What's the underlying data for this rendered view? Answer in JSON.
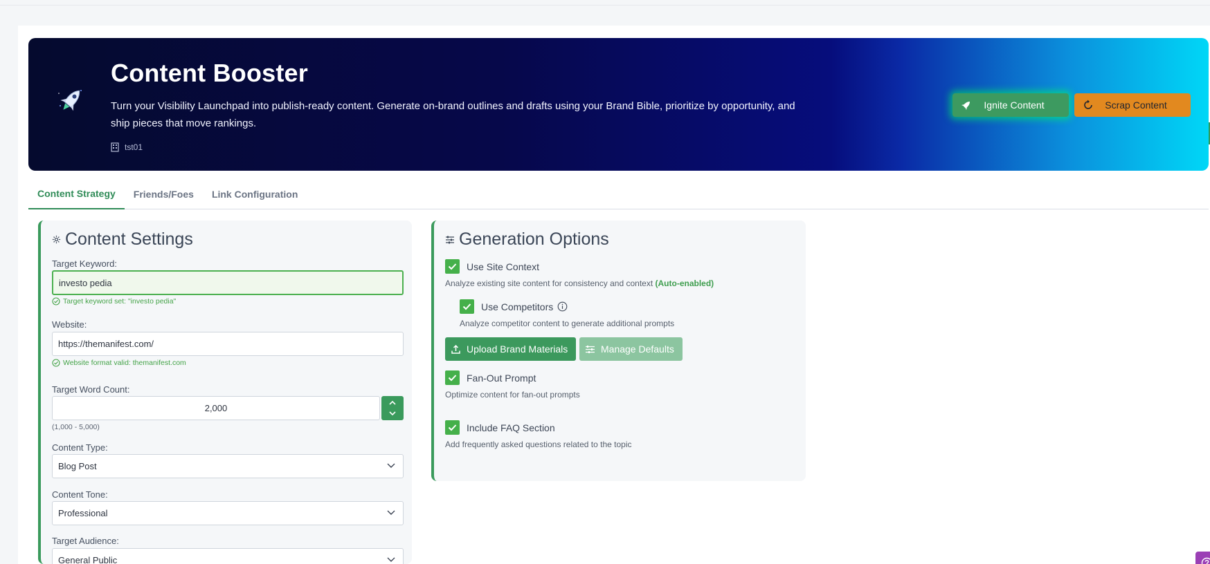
{
  "hero": {
    "title": "Content Booster",
    "description": "Turn your Visibility Launchpad into publish-ready content. Generate on-brand outlines and drafts using your Brand Bible, prioritize by opportunity, and ship pieces that move rankings.",
    "org": "tst01",
    "ignite_label": "Ignite Content",
    "scrap_label": "Scrap Content"
  },
  "tabs": [
    {
      "label": "Content Strategy",
      "active": true
    },
    {
      "label": "Friends/Foes",
      "active": false
    },
    {
      "label": "Link Configuration",
      "active": false
    }
  ],
  "content_settings": {
    "title": "Content Settings",
    "keyword_label": "Target Keyword:",
    "keyword_value": "investo pedia",
    "keyword_hint": "Target keyword set: \"investo pedia\"",
    "website_label": "Website:",
    "website_value": "https://themanifest.com/",
    "website_hint": "Website format valid: themanifest.com",
    "word_count_label": "Target Word Count:",
    "word_count_value": "2,000",
    "word_count_range": "(1,000 - 5,000)",
    "content_type_label": "Content Type:",
    "content_type_value": "Blog Post",
    "tone_label": "Content Tone:",
    "tone_value": "Professional",
    "audience_label": "Target Audience:",
    "audience_value": "General Public"
  },
  "generation_options": {
    "title": "Generation Options",
    "site_context_label": "Use Site Context",
    "site_context_desc": "Analyze existing site content for consistency and context",
    "site_context_auto": "(Auto-enabled)",
    "competitors_label": "Use Competitors",
    "competitors_desc": "Analyze competitor content to generate additional prompts",
    "upload_label": "Upload Brand Materials",
    "manage_label": "Manage Defaults",
    "fanout_label": "Fan-Out Prompt",
    "fanout_desc": "Optimize content for fan-out prompts",
    "faq_label": "Include FAQ Section",
    "faq_desc": "Add frequently asked questions related to the topic"
  },
  "colors": {
    "accent_green": "#3a9a5c",
    "check_green": "#45b04a",
    "scrap_orange": "#e2891f",
    "help_purple": "#9b3fb5"
  },
  "icons": [
    "rocket-icon",
    "building-icon",
    "refresh-icon",
    "gear-icon",
    "sliders-icon",
    "check-circle-icon",
    "chevron-down-icon",
    "chevron-up-icon",
    "info-icon",
    "upload-icon",
    "help-icon"
  ]
}
